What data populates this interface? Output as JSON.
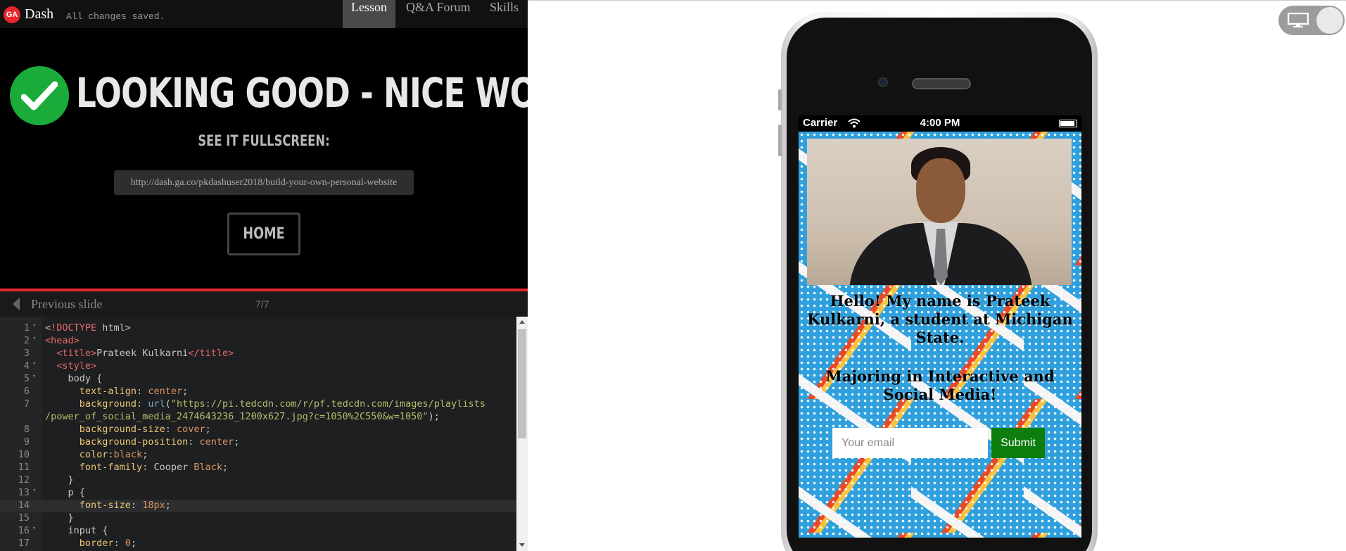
{
  "app": {
    "logo_text": "GA",
    "brand": "Dash",
    "save_status": "All changes saved."
  },
  "nav": {
    "tabs": [
      {
        "label": "Lesson",
        "active": true
      },
      {
        "label": "Q&A Forum",
        "active": false
      },
      {
        "label": "Skills",
        "active": false
      }
    ]
  },
  "hero": {
    "title": "LOOKING GOOD - NICE WORK!",
    "fullscreen_label": "SEE IT FULLSCREEN:",
    "url": "http://dash.ga.co/pkdashuser2018/build-your-own-personal-website",
    "home_label": "HOME"
  },
  "slides": {
    "prev_label": "Previous slide",
    "counter": "7/7"
  },
  "editor": {
    "line_numbers": [
      "1",
      "2",
      "3",
      "4",
      "5",
      "6",
      "7",
      "",
      "8",
      "9",
      "10",
      "11",
      "12",
      "13",
      "14",
      "15",
      "16",
      "17"
    ]
  },
  "preview": {
    "status_bar": {
      "carrier": "Carrier",
      "time": "4:00 PM"
    },
    "bio_line1": "Hello! My name is Prateek Kulkarni, a student at Michigan State.",
    "bio_line2": "Majoring in Interactive and Social Media!",
    "email_placeholder": "Your email",
    "submit_label": "Submit"
  },
  "colors": {
    "accent_red": "#e8262e",
    "success_green": "#1aab3a",
    "submit_green": "#0d7d0d"
  }
}
